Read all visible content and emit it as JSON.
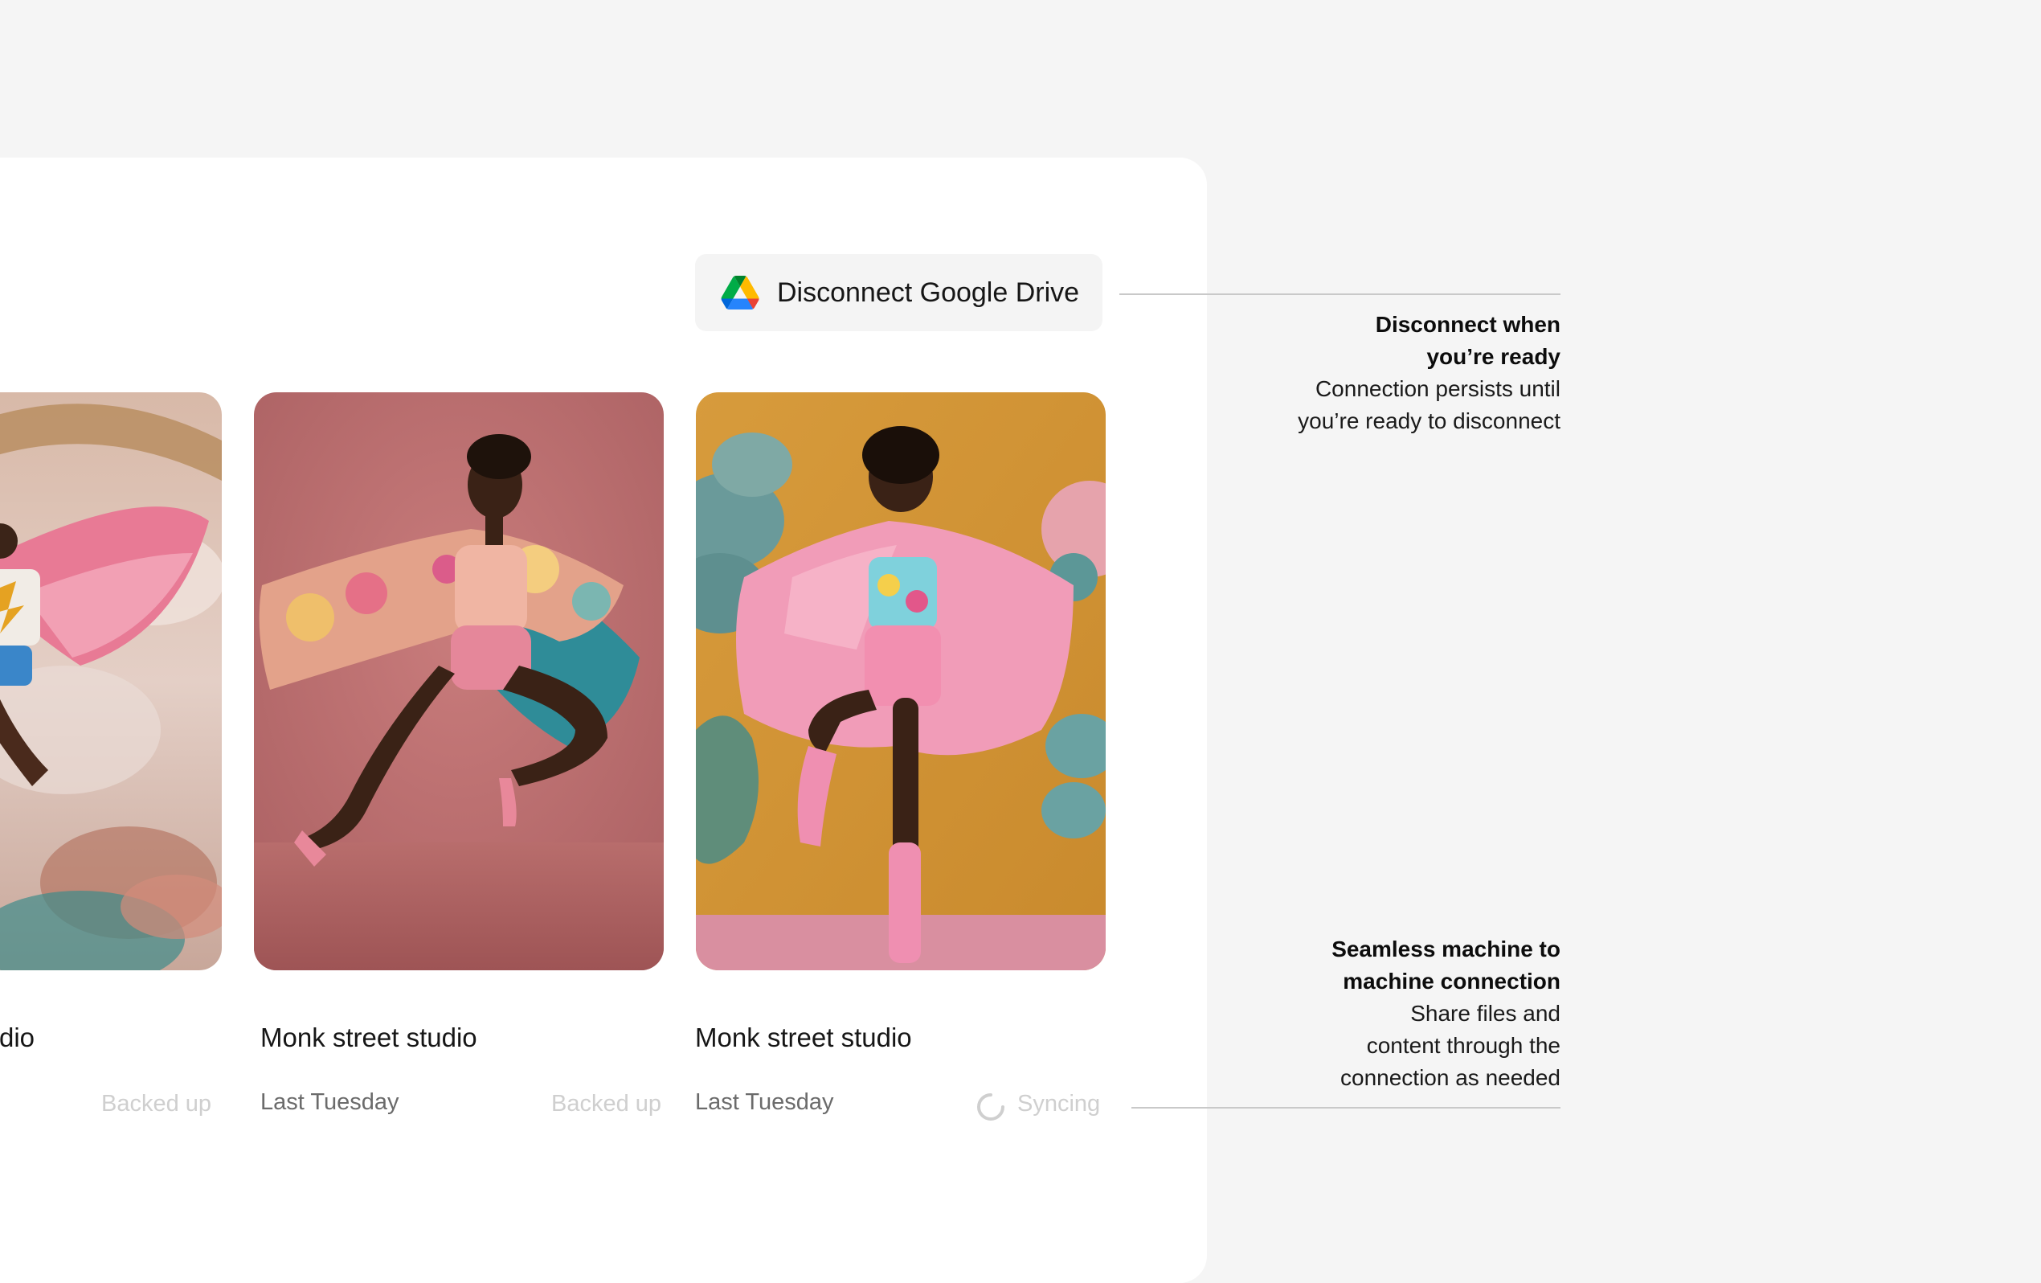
{
  "toolbar": {
    "disconnect_label": "Disconnect Google Drive",
    "icon": "google-drive-icon"
  },
  "cards": [
    {
      "title": "dio",
      "date": "",
      "status": "Backed up",
      "image_description_icon": "photo-pink-cape-mural"
    },
    {
      "title": "Monk street studio",
      "date": "Last Tuesday",
      "status": "Backed up",
      "image_description_icon": "photo-floral-cape-pink-backdrop"
    },
    {
      "title": "Monk street studio",
      "date": "Last Tuesday",
      "status": "Syncing",
      "image_description_icon": "photo-pink-cape-yellow-backdrop"
    }
  ],
  "annotations": [
    {
      "heading_line1": "Disconnect when",
      "heading_line2": "you’re ready",
      "body_line1": "Connection persists until",
      "body_line2": "you’re ready to disconnect"
    },
    {
      "heading_line1": "Seamless machine to",
      "heading_line2": "machine connection",
      "body_line1": "Share files and",
      "body_line2": "content through the",
      "body_line3": "connection as needed"
    }
  ],
  "colors": {
    "page_bg": "#f5f5f5",
    "panel_bg": "#ffffff",
    "button_bg": "#f4f4f4",
    "muted_status": "#cfcfcf",
    "date_text": "#6b6b6b",
    "connector": "#c9c9c9"
  }
}
